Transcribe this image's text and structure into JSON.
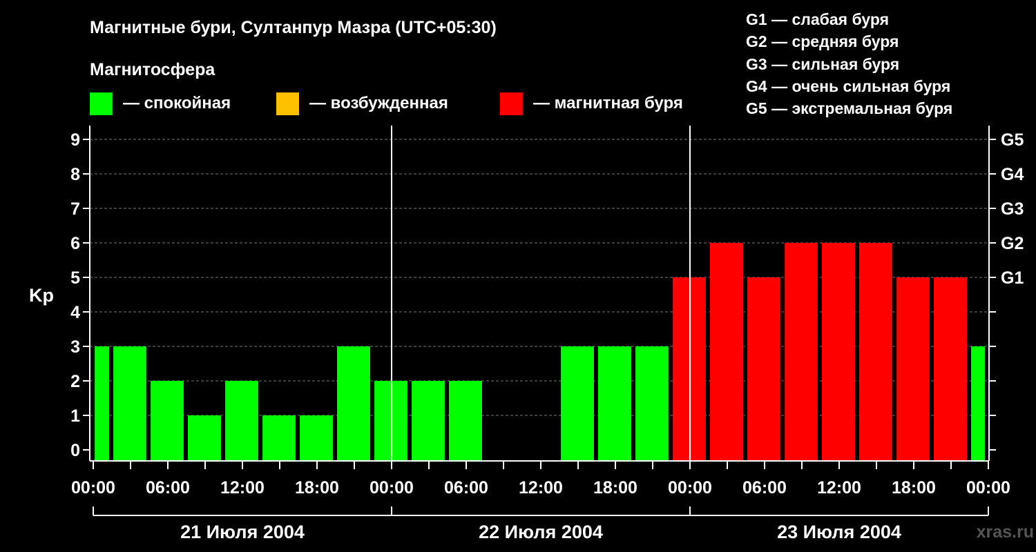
{
  "chart_data": {
    "type": "bar",
    "title": "Магнитные бури, Султанпур Мазра (UTC+05:30)",
    "legend_title": "Магнитосфера",
    "legend": [
      {
        "key": "quiet",
        "label": "— спокойная",
        "color": "#00ff00"
      },
      {
        "key": "active",
        "label": "— возбужденная",
        "color": "#ffc000"
      },
      {
        "key": "storm",
        "label": "— магнитная буря",
        "color": "#ff0000"
      }
    ],
    "g_scale_legend": [
      "G1 — слабая буря",
      "G2 — средняя буря",
      "G3 — сильная буря",
      "G4 — очень сильная буря",
      "G5 — экстремальная буря"
    ],
    "ylabel": "Kp",
    "ylim": [
      0,
      9
    ],
    "yticks": [
      0,
      1,
      2,
      3,
      4,
      5,
      6,
      7,
      8,
      9
    ],
    "right_ticks": [
      {
        "kp": 5,
        "label": "G1"
      },
      {
        "kp": 6,
        "label": "G2"
      },
      {
        "kp": 7,
        "label": "G3"
      },
      {
        "kp": 8,
        "label": "G4"
      },
      {
        "kp": 9,
        "label": "G5"
      }
    ],
    "grid": true,
    "x_tick_labels": [
      "00:00",
      "06:00",
      "12:00",
      "18:00",
      "00:00",
      "06:00",
      "12:00",
      "18:00",
      "00:00",
      "06:00",
      "12:00",
      "18:00",
      "00:00"
    ],
    "days": [
      "21 Июля 2004",
      "22 Июля 2004",
      "23 Июля 2004"
    ],
    "interval_hours": 3,
    "bars": [
      {
        "start_hour": -1.5,
        "kp": 3
      },
      {
        "start_hour": 1.5,
        "kp": 3
      },
      {
        "start_hour": 4.5,
        "kp": 2
      },
      {
        "start_hour": 7.5,
        "kp": 1
      },
      {
        "start_hour": 10.5,
        "kp": 2
      },
      {
        "start_hour": 13.5,
        "kp": 1
      },
      {
        "start_hour": 16.5,
        "kp": 1
      },
      {
        "start_hour": 19.5,
        "kp": 3
      },
      {
        "start_hour": 22.5,
        "kp": 2
      },
      {
        "start_hour": 25.5,
        "kp": 2
      },
      {
        "start_hour": 28.5,
        "kp": 2
      },
      {
        "start_hour": 31.5,
        "kp": 0
      },
      {
        "start_hour": 34.5,
        "kp": 0
      },
      {
        "start_hour": 37.5,
        "kp": 3
      },
      {
        "start_hour": 40.5,
        "kp": 3
      },
      {
        "start_hour": 43.5,
        "kp": 3
      },
      {
        "start_hour": 46.5,
        "kp": 5
      },
      {
        "start_hour": 49.5,
        "kp": 6
      },
      {
        "start_hour": 52.5,
        "kp": 5
      },
      {
        "start_hour": 55.5,
        "kp": 6
      },
      {
        "start_hour": 58.5,
        "kp": 6
      },
      {
        "start_hour": 61.5,
        "kp": 6
      },
      {
        "start_hour": 64.5,
        "kp": 5
      },
      {
        "start_hour": 67.5,
        "kp": 5
      },
      {
        "start_hour": 70.5,
        "kp": 3
      }
    ],
    "watermark": "xras.ru"
  }
}
